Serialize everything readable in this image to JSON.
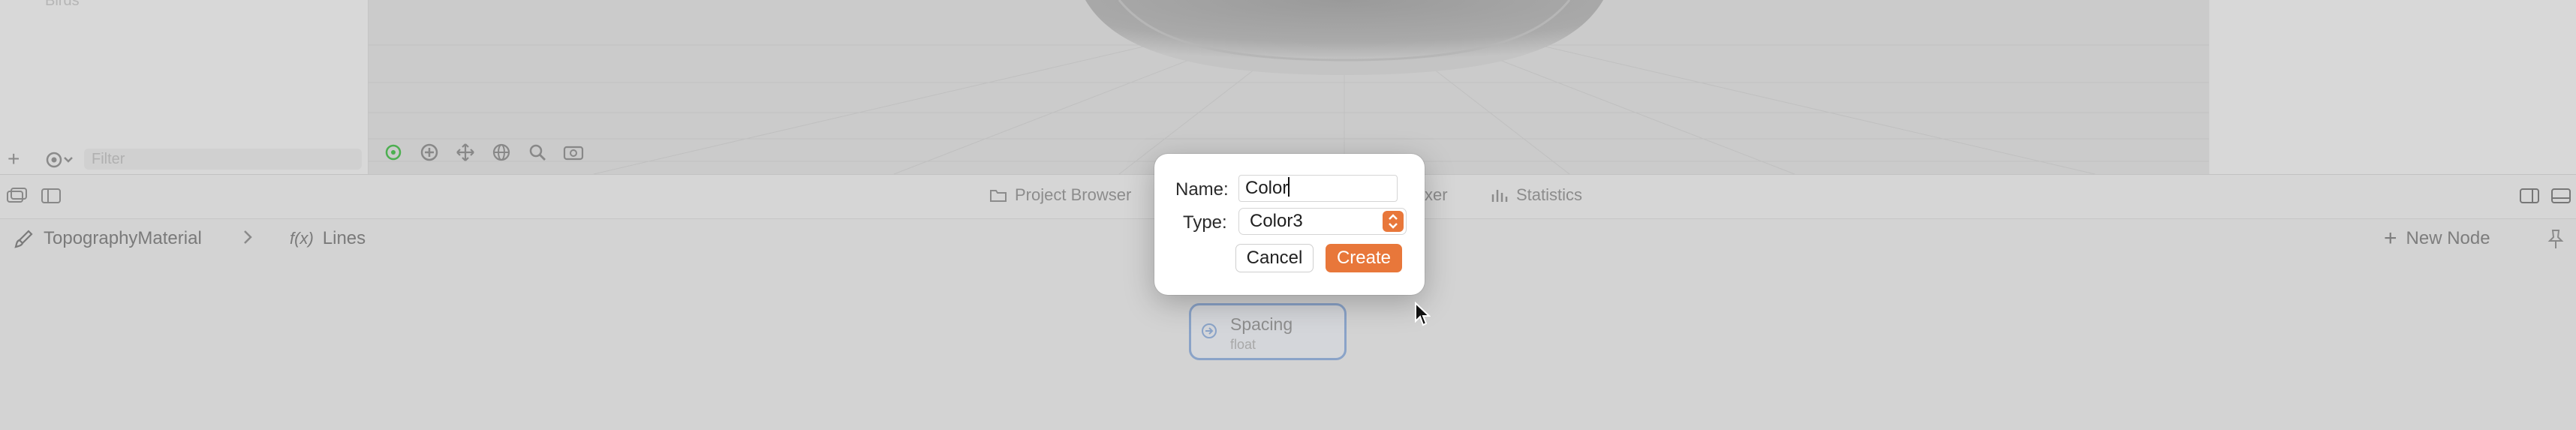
{
  "left_panel": {
    "ghost_item": "Birds",
    "filter_placeholder": "Filter"
  },
  "tabs": [
    {
      "label": "Project Browser",
      "icon": "folder-icon"
    },
    {
      "label": "xer",
      "icon": "audio-mixer-icon"
    },
    {
      "label": "Statistics",
      "icon": "bar-chart-icon"
    }
  ],
  "breadcrumb": {
    "material": "TopographyMaterial",
    "function": "Lines",
    "function_icon": "f(x)"
  },
  "toolbar": {
    "new_node_label": "New Node"
  },
  "graph_node": {
    "name": "Spacing",
    "type": "float"
  },
  "dialog": {
    "name_label": "Name:",
    "name_value": "Color",
    "type_label": "Type:",
    "type_value": "Color3",
    "cancel_label": "Cancel",
    "create_label": "Create"
  },
  "colors": {
    "accent": "#e8773a",
    "node_border": "#8aa3c8",
    "background": "#d3d3d3"
  }
}
